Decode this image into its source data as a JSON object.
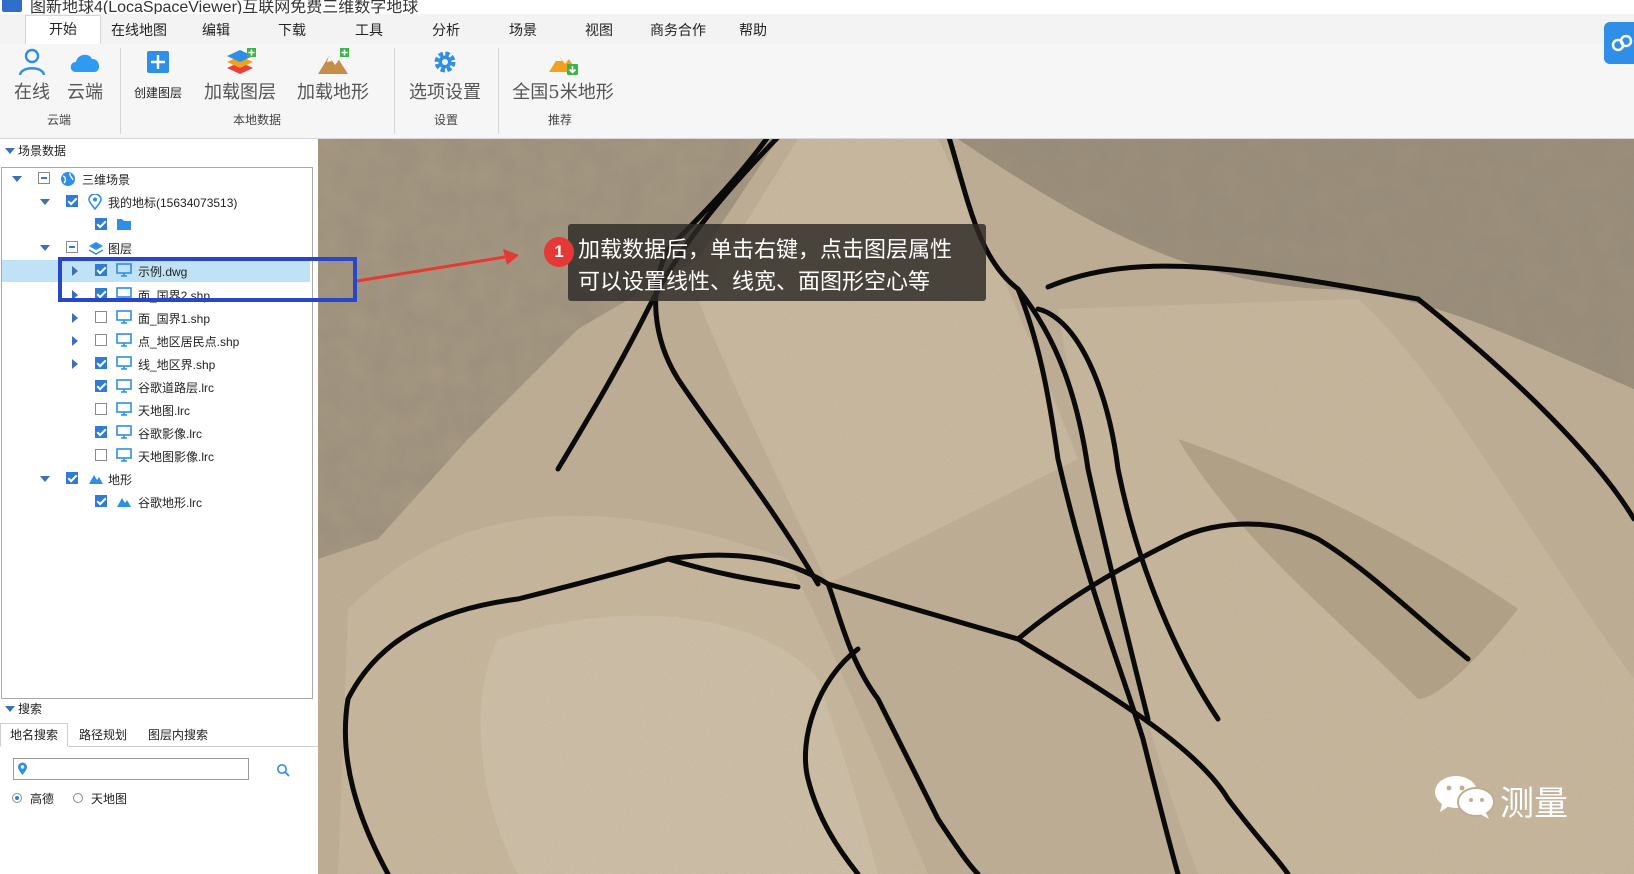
{
  "window": {
    "title": "图新地球4(LocaSpaceViewer)互联网免费三维数字地球"
  },
  "menu": {
    "tabs": [
      {
        "label": "开始"
      },
      {
        "label": "在线地图"
      },
      {
        "label": "编辑"
      },
      {
        "label": "下载"
      },
      {
        "label": "工具"
      },
      {
        "label": "分析"
      },
      {
        "label": "场景"
      },
      {
        "label": "视图"
      },
      {
        "label": "商务合作"
      },
      {
        "label": "帮助"
      }
    ],
    "active_index": 0
  },
  "ribbon": {
    "groups": [
      {
        "label": "云端"
      },
      {
        "label": "本地数据"
      },
      {
        "label": "设置"
      },
      {
        "label": "推荐"
      }
    ],
    "buttons": {
      "online": "在线",
      "cloud": "云端",
      "create_layer": "创建图层",
      "load_layer": "加载图层",
      "load_terrain": "加载地形",
      "options": "选项设置",
      "national_5m": "全国5米地形"
    }
  },
  "scene_panel": {
    "title": "场景数据",
    "tree": [
      {
        "label": "三维场景",
        "icon": "globe-icon",
        "check": "partial",
        "expander": "down"
      },
      {
        "label": "我的地标(15634073513)",
        "icon": "location-pin-icon",
        "check": "on",
        "expander": "down"
      },
      {
        "label": "",
        "icon": "folder-icon",
        "check": "on",
        "expander": "none"
      },
      {
        "label": "图层",
        "icon": "layers-icon",
        "check": "partial",
        "expander": "down"
      },
      {
        "label": "示例.dwg",
        "icon": "monitor-icon",
        "check": "on",
        "expander": "right",
        "selected": true
      },
      {
        "label": "面_国界2.shp",
        "icon": "monitor-icon",
        "check": "on",
        "expander": "right"
      },
      {
        "label": "面_国界1.shp",
        "icon": "monitor-icon",
        "check": "off",
        "expander": "right"
      },
      {
        "label": "点_地区居民点.shp",
        "icon": "monitor-icon",
        "check": "off",
        "expander": "right"
      },
      {
        "label": "线_地区界.shp",
        "icon": "monitor-icon",
        "check": "on",
        "expander": "right"
      },
      {
        "label": "谷歌道路层.lrc",
        "icon": "monitor-icon",
        "check": "on",
        "expander": "none"
      },
      {
        "label": "天地图.lrc",
        "icon": "monitor-icon",
        "check": "off",
        "expander": "none"
      },
      {
        "label": "谷歌影像.lrc",
        "icon": "monitor-icon",
        "check": "on",
        "expander": "none"
      },
      {
        "label": "天地图影像.lrc",
        "icon": "monitor-icon",
        "check": "off",
        "expander": "none"
      },
      {
        "label": "地形",
        "icon": "terrain-icon",
        "check": "on",
        "expander": "down"
      },
      {
        "label": "谷歌地形.lrc",
        "icon": "terrain-icon",
        "check": "on",
        "expander": "none"
      }
    ]
  },
  "search_panel": {
    "title": "搜索",
    "tabs": [
      {
        "label": "地名搜索"
      },
      {
        "label": "路径规划"
      },
      {
        "label": "图层内搜索"
      }
    ],
    "input_value": "",
    "radios": [
      {
        "label": "高德",
        "checked": true
      },
      {
        "label": "天地图",
        "checked": false
      }
    ]
  },
  "annotation": {
    "badge": "1",
    "lines": [
      "加载数据后，单击右键，点击图层属性",
      "可以设置线性、线宽、面图形空心等"
    ]
  },
  "watermark": {
    "text": "测量"
  },
  "colors": {
    "accent": "#2f7bd6",
    "highlight": "#2846c8",
    "badge": "#e53935",
    "arrow": "#e53935"
  }
}
